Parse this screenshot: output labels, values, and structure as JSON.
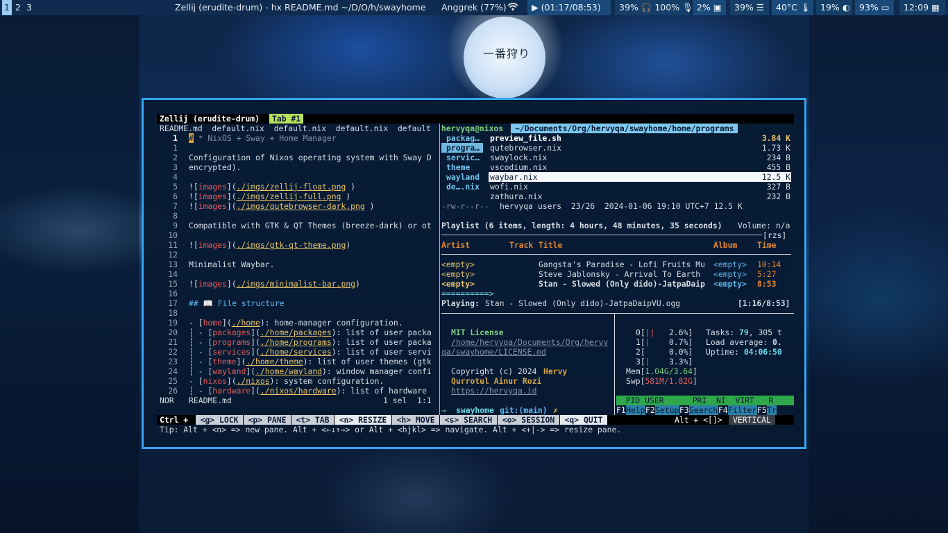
{
  "topbar": {
    "workspaces": [
      "1",
      "2",
      "3"
    ],
    "title": "Zellij (erudite-drum) - hx README.md ~/D/O/h/swayhome",
    "wifi": "Anggrek (77%)",
    "media": "(01:17/08:53)",
    "volume": "39%",
    "headphones": "100%",
    "cpu": "2%",
    "memory": "39%",
    "temperature": "40°C",
    "brightness": "19%",
    "battery": "93%",
    "clock": "12:09"
  },
  "zellij": {
    "session": "Zellij (erudite-drum)",
    "tab": "Tab #1",
    "status": {
      "ctrl": "Ctrl +",
      "items": [
        "<g> LOCK",
        "<p> PANE",
        "<t> TAB",
        "<n> RESIZE",
        "<h> MOVE",
        "<s> SEARCH",
        "<o> SESSION",
        "<q> QUIT"
      ],
      "alt": "Alt + <[]>",
      "layout": "VERTICAL"
    },
    "tip": {
      "label": "Tip:",
      "text": "Alt + <n> => new pane. Alt + <←↓↑→> or Alt + <hjkl> => navigate. Alt + <+|-> => resize pane."
    }
  },
  "editor": {
    "buffers": "README.md  default.nix  default.nix  default.nix  default",
    "lines": [
      {
        "n": "1",
        "txt": "# * NixOS + Sway + Home Manager",
        "cur": true
      },
      {
        "n": "1",
        "txt": ""
      },
      {
        "n": "2",
        "txt": "Configuration of Nixos operating system with Sway D"
      },
      {
        "n": "3",
        "txt": "encrypted)."
      },
      {
        "n": "4",
        "txt": ""
      },
      {
        "n": "5",
        "pre": "![",
        "red": "images",
        "mid": "](",
        "link": "./imgs/zellij-float.png",
        "post": " )"
      },
      {
        "n": "6",
        "pre": "![",
        "red": "images",
        "mid": "](",
        "link": "./imgs/zellij-full.png",
        "post": " )"
      },
      {
        "n": "7",
        "pre": "![",
        "red": "images",
        "mid": "](",
        "link": "./imgs/qutebrowser-dark.png",
        "post": " )"
      },
      {
        "n": "8",
        "txt": ""
      },
      {
        "n": "9",
        "txt": "Compatible with GTK & QT Themes (breeze-dark) or ot"
      },
      {
        "n": "10",
        "txt": ""
      },
      {
        "n": "11",
        "pre": "![",
        "red": "images",
        "mid": "](",
        "link": "./imgs/gtk-qt-theme.png",
        "post": ")"
      },
      {
        "n": "12",
        "txt": ""
      },
      {
        "n": "13",
        "txt": "Minimalist Waybar."
      },
      {
        "n": "14",
        "txt": ""
      },
      {
        "n": "15",
        "pre": "![",
        "red": "images",
        "mid": "](",
        "link": "./imgs/minimalist-bar.png",
        "post": ")"
      },
      {
        "n": "16",
        "txt": ""
      },
      {
        "n": "17",
        "heading": "## 📖 File structure"
      },
      {
        "n": "18",
        "txt": ""
      },
      {
        "n": "19",
        "pre": "- [",
        "red": "home",
        "mid": "](",
        "link": "./home",
        "post": "): home-manager configuration."
      },
      {
        "n": "20",
        "pre": "┆ - [",
        "red": "packages",
        "mid": "](",
        "link": "./home/packages",
        "post": "): list of user packa"
      },
      {
        "n": "21",
        "pre": "┆ - [",
        "red": "programs",
        "mid": "](",
        "link": "./home/programs",
        "post": "): list of user packa"
      },
      {
        "n": "22",
        "pre": "┆ - [",
        "red": "services",
        "mid": "](",
        "link": "./home/services",
        "post": "): list of user servi"
      },
      {
        "n": "23",
        "pre": "┆ - [",
        "red": "theme",
        "mid": "](",
        "link": "./home/theme",
        "post": "): list of user themes (gtk"
      },
      {
        "n": "24",
        "pre": "┆ - [",
        "red": "wayland",
        "mid": "](",
        "link": "./home/wayland",
        "post": "): window manager confi"
      },
      {
        "n": "25",
        "pre": "- [",
        "red": "nixos",
        "mid": "](",
        "link": "./nixos",
        "post": "): system configuration."
      },
      {
        "n": "26",
        "pre": "┆ - [",
        "red": "hardware",
        "mid": "](",
        "link": "./nixos/hardware",
        "post": "): list of hardware"
      }
    ],
    "mode": "NOR",
    "file": "README.md",
    "selection": "1 sel",
    "position": "1:1"
  },
  "files": {
    "host": "hervyqa@nixos",
    "path": "~/Documents/Org/hervyqa/swayhome/home/programs",
    "dirs": [
      "packag…",
      "progra…",
      "servic…",
      "theme",
      "wayland",
      "de….nix"
    ],
    "entries": [
      {
        "name": "preview_file.sh",
        "size": "3.84 K",
        "bold": true
      },
      {
        "name": "qutebrowser.nix",
        "size": "1.73 K"
      },
      {
        "name": "swaylock.nix",
        "size": "234 B"
      },
      {
        "name": "vscodium.nix",
        "size": "455 B"
      },
      {
        "name": "waybar.nix",
        "size": "12.5 K",
        "selected": true
      },
      {
        "name": "wofi.nix",
        "size": "327 B"
      },
      {
        "name": "zathura.nix",
        "size": "232 B"
      }
    ],
    "footer_perm": "-rw-r--r--",
    "footer_info": "hervyqa users  23/26  2024-01-06 19:10 UTC+7 12.5 K"
  },
  "playlist": {
    "header": "Playlist (6 items, length: 4 hours, 48 minutes, 35 seconds)",
    "volume": "Volume: n/a",
    "tag": "[rzs]",
    "columns": [
      "Artist",
      "Track",
      "Title",
      "Album",
      "Time"
    ],
    "rows": [
      {
        "artist": "<empty>",
        "title": "Gangsta's Paradise - Lofi Fruits Mu",
        "album": "<empty>",
        "time": "10:14"
      },
      {
        "artist": "<empty>",
        "title": "Steve Jablonsky - Arrival To Earth",
        "album": "<empty>",
        "time": "5:27"
      },
      {
        "artist": "<empty>",
        "title": "Stan - Slowed (Only dido)-JatpaDaip",
        "album": "<empty>",
        "time": "8:53",
        "bold": true
      }
    ],
    "progress": "==========>",
    "playing_label": "Playing:",
    "playing": "Stan - Slowed (Only dido)-JatpaDaipVU.ogg",
    "elapsed": "[1:16/8:53]"
  },
  "license": {
    "title": "MIT License",
    "path1": "/home/hervyqa/Documents/Org/hervy",
    "path2": "qa/swayhome/LICENSE.md",
    "copyright": "Copyright (c) 2024",
    "author1": "Hervy",
    "author2": "Qurrotul Ainur Rozi",
    "url": "https://hervyqa.id",
    "prompt_dir": "swayhome",
    "prompt_git": "git:(main)",
    "prompt_mark": "✗"
  },
  "htop": {
    "cpus": [
      {
        "id": "0",
        "bar": "||",
        "pct": "2.6%"
      },
      {
        "id": "1",
        "bar": "|",
        "pct": "0.7%"
      },
      {
        "id": "2",
        "bar": "",
        "pct": "0.0%"
      },
      {
        "id": "3",
        "bar": "|",
        "pct": "3.3%"
      }
    ],
    "mem": "1.04G/3.64",
    "swp": "581M/1.82G",
    "tasks_label": "Tasks:",
    "tasks": "79",
    "tasks_rest": ", 305 t",
    "load_label": "Load average:",
    "load": "0.",
    "uptime_label": "Uptime:",
    "uptime": "04:06:50",
    "header": "  PID USER      PRI  NI  VIRT   R",
    "fkeys": [
      {
        "k": "F1",
        "l": "Help"
      },
      {
        "k": "F2",
        "l": "Setup"
      },
      {
        "k": "F3",
        "l": "Search"
      },
      {
        "k": "F4",
        "l": "Filter"
      },
      {
        "k": "F5",
        "l": "Tr"
      }
    ]
  }
}
